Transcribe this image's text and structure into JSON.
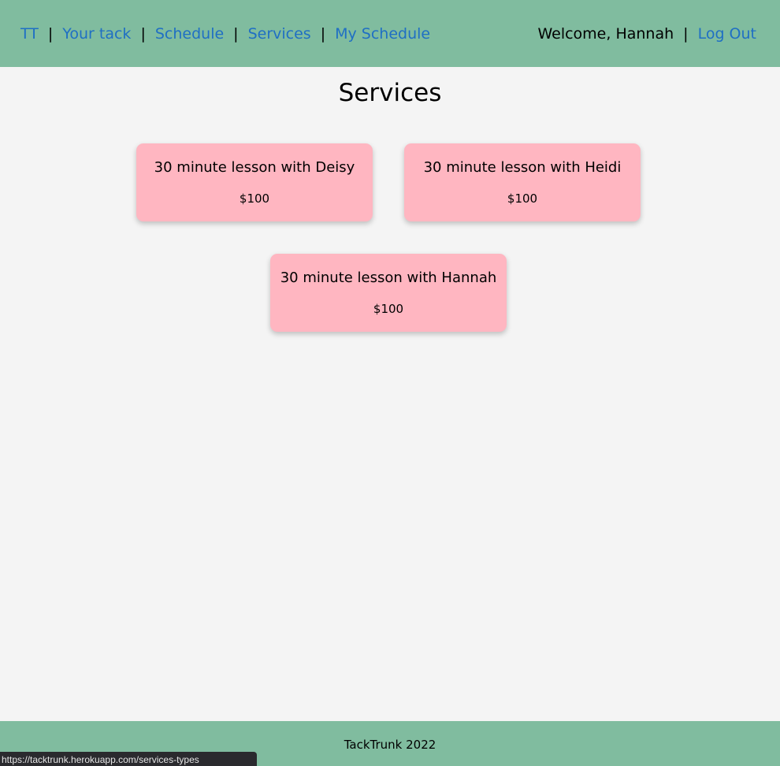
{
  "nav": {
    "brand": "TT",
    "links": [
      "Your tack",
      "Schedule",
      "Services",
      "My Schedule"
    ],
    "separator": "|"
  },
  "account": {
    "welcome": "Welcome, Hannah",
    "logout": "Log Out"
  },
  "page": {
    "title": "Services"
  },
  "services": [
    {
      "name": "30 minute lesson with Deisy",
      "price": "$100"
    },
    {
      "name": "30 minute lesson with Heidi",
      "price": "$100"
    },
    {
      "name": "30 minute lesson with Hannah",
      "price": "$100"
    }
  ],
  "footer": {
    "text": "TackTrunk 2022"
  },
  "status_bar": {
    "url": "https://tacktrunk.herokuapp.com/services-types"
  },
  "colors": {
    "header_bg": "#80bc9f",
    "link": "#1f6fc4",
    "card_bg": "#ffb6c1",
    "page_bg": "#f4f4f4"
  }
}
